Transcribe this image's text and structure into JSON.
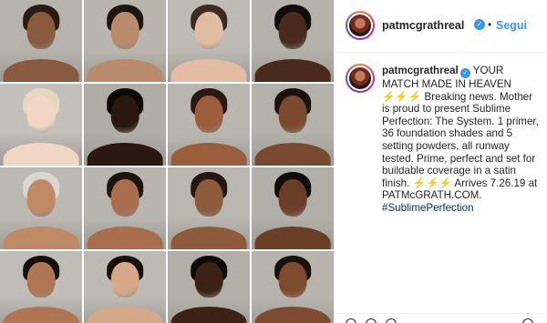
{
  "post": {
    "username": "patmcgrathreal",
    "follow_label": "Segui",
    "separator": "•",
    "verified_icon": "verified-badge-icon"
  },
  "caption": {
    "username": "patmcgrathreal",
    "text_1": "YOUR MATCH MADE IN HEAVEN ⚡⚡⚡ Breaking news. Mother is proud to present Sublime Perfection: The System. 1 primer, 36 foundation shades and 5 setting powders, all runway tested. Prime, perfect and set for buildable coverage in a satin finish. ⚡⚡⚡ Arrives 7.26.19 at",
    "url": "PATMcGRATH.COM.",
    "hashtag": "#SublimePerfection"
  },
  "colors": {
    "link_blue": "#3897f0",
    "hashtag_navy": "#003569",
    "text": "#262626",
    "border": "#efefef"
  },
  "photo_grid": {
    "tiles": [
      {
        "bg": "#b6b3ad",
        "skin": "#8a5a3e",
        "hair": "#2a1c14"
      },
      {
        "bg": "#b9b5ae",
        "skin": "#b98a6b",
        "hair": "#1f1610"
      },
      {
        "bg": "#bebbb6",
        "skin": "#e3bca3",
        "hair": "#3b2b22"
      },
      {
        "bg": "#b5b2ac",
        "skin": "#4a2a1c",
        "hair": "#140d09"
      },
      {
        "bg": "#c3c0bb",
        "skin": "#f1d6c5",
        "hair": "#e5d7c2"
      },
      {
        "bg": "#b0ada7",
        "skin": "#2a1810",
        "hair": "#0e0907"
      },
      {
        "bg": "#b9b6b0",
        "skin": "#9a5e3c",
        "hair": "#2a1a12"
      },
      {
        "bg": "#b4b1ab",
        "skin": "#7a4a30",
        "hair": "#1c120c"
      },
      {
        "bg": "#bcb9b3",
        "skin": "#c08a66",
        "hair": "#d9d7d2"
      },
      {
        "bg": "#b8b5af",
        "skin": "#a86e4e",
        "hair": "#1e140e"
      },
      {
        "bg": "#bab7b1",
        "skin": "#8e5a3c",
        "hair": "#231710"
      },
      {
        "bg": "#b2afa9",
        "skin": "#6a3d26",
        "hair": "#0f0b09"
      },
      {
        "bg": "#c0bdb8",
        "skin": "#b07552",
        "hair": "#150f0b"
      },
      {
        "bg": "#bdbab4",
        "skin": "#d6a88a",
        "hair": "#17110d"
      },
      {
        "bg": "#b3b0aa",
        "skin": "#3c2216",
        "hair": "#0d0907"
      },
      {
        "bg": "#b7b4ae",
        "skin": "#7e4b30",
        "hair": "#1a110b"
      }
    ]
  }
}
